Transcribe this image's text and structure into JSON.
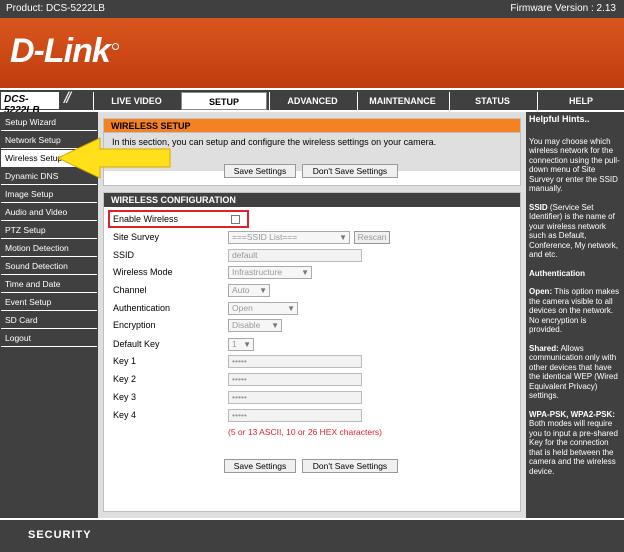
{
  "topbar": {
    "product": "Product: DCS-5222LB",
    "firmware": "Firmware Version : 2.13"
  },
  "brand": {
    "logo": "D-Link"
  },
  "nav": {
    "model": "DCS-5222LB",
    "tabs": [
      "LIVE VIDEO",
      "SETUP",
      "ADVANCED",
      "MAINTENANCE",
      "STATUS",
      "HELP"
    ]
  },
  "sidebar": {
    "items": [
      "Setup Wizard",
      "Network Setup",
      "Wireless Setup",
      "Dynamic DNS",
      "Image Setup",
      "Audio and Video",
      "PTZ Setup",
      "Motion Detection",
      "Sound Detection",
      "Time and Date",
      "Event Setup",
      "SD Card",
      "Logout"
    ]
  },
  "wireless_setup": {
    "title": "WIRELESS SETUP",
    "intro": "In this section, you can setup and configure the wireless settings on your camera.",
    "save": "Save Settings",
    "dont_save": "Don't Save Settings"
  },
  "config": {
    "title": "WIRELESS CONFIGURATION",
    "enable_wireless": "Enable Wireless",
    "site_survey": "Site Survey",
    "site_survey_value": "===SSID List===",
    "rescan": "Rescan",
    "ssid": "SSID",
    "ssid_value": "default",
    "wireless_mode": "Wireless Mode",
    "wireless_mode_value": "Infrastructure",
    "channel": "Channel",
    "channel_value": "Auto",
    "authentication": "Authentication",
    "authentication_value": "Open",
    "encryption": "Encryption",
    "encryption_value": "Disable",
    "default_key": "Default Key",
    "default_key_value": "1",
    "key1": "Key 1",
    "key2": "Key 2",
    "key3": "Key 3",
    "key4": "Key 4",
    "key_mask": "•••••",
    "key_note": "(5 or 13 ASCII, 10 or 26 HEX characters)",
    "save": "Save Settings",
    "dont_save": "Don't Save Settings"
  },
  "hints": {
    "title": "Helpful Hints..",
    "p1": "You may choose which wireless network for the connection using the pull-down menu of Site Survey or enter the SSID manually.",
    "p2_head": "SSID",
    "p2": " (Service Set Identifier) is the name of your wireless network such as Default, Conference, My network, and etc.",
    "p3_head": "Authentication",
    "p4_head": "Open:",
    "p4": " This option makes the camera visible to all devices on the network. No encryption is provided.",
    "p5_head": "Shared:",
    "p5": " Allows communication only with other devices that have the identical WEP (Wired Equivalent Privacy) settings.",
    "p6_head": "WPA-PSK, WPA2-PSK:",
    "p6": " Both modes will require you to input a pre-shared Key for the connection that is held between the camera and the wireless device."
  },
  "footer": {
    "label": "SECURITY"
  },
  "colors": {
    "accent": "#f58220",
    "dark": "#404040",
    "highlight": "#e0202a",
    "arrow": "#ffe01a"
  }
}
